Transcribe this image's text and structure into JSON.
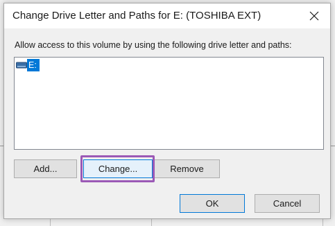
{
  "dialog": {
    "title": "Change Drive Letter and Paths for E: (TOSHIBA EXT)",
    "prompt": "Allow access to this volume by using the following drive letter and paths:",
    "list_items": [
      {
        "label": "E:",
        "icon": "drive-icon",
        "selected": true
      }
    ],
    "buttons": {
      "add": "Add...",
      "change": "Change...",
      "remove": "Remove",
      "ok": "OK",
      "cancel": "Cancel"
    },
    "highlight_color": "#9b59b6",
    "accent_color": "#0078d7"
  }
}
